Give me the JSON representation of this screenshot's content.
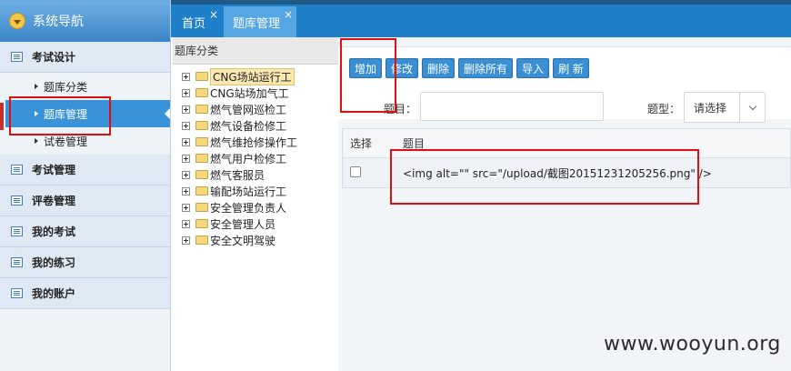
{
  "sidebar": {
    "header": "系统导航",
    "groups": [
      {
        "label": "考试设计"
      },
      {
        "label": "考试管理"
      },
      {
        "label": "评卷管理"
      },
      {
        "label": "我的考试"
      },
      {
        "label": "我的练习"
      },
      {
        "label": "我的账户"
      }
    ],
    "subitems": [
      {
        "label": "题库分类"
      },
      {
        "label": "题库管理"
      },
      {
        "label": "试卷管理"
      }
    ]
  },
  "tabs": [
    {
      "label": "首页",
      "close": "×"
    },
    {
      "label": "题库管理",
      "close": "×"
    }
  ],
  "category_panel": {
    "title": "题库分类",
    "nodes": [
      {
        "label": "CNG场站运行工"
      },
      {
        "label": "CNG站场加气工"
      },
      {
        "label": "燃气管网巡检工"
      },
      {
        "label": "燃气设备检修工"
      },
      {
        "label": "燃气维抢修操作工"
      },
      {
        "label": "燃气用户检修工"
      },
      {
        "label": "燃气客服员"
      },
      {
        "label": "输配场站运行工"
      },
      {
        "label": "安全管理负责人"
      },
      {
        "label": "安全管理人员"
      },
      {
        "label": "安全文明驾驶"
      }
    ]
  },
  "toolbar": {
    "add": "增加",
    "edit": "修改",
    "delete": "删除",
    "delete_all": "删除所有",
    "import": "导入",
    "refresh": "刷 新"
  },
  "filters": {
    "question_label": "题目：",
    "question_value": "",
    "type_label": "题型：",
    "type_value": "请选择"
  },
  "grid": {
    "headers": {
      "select": "选择",
      "question": "题目"
    },
    "rows": [
      {
        "question": "<img alt=\"\" src=\"/upload/截图20151231205256.png\" />"
      }
    ]
  },
  "watermark": "www.wooyun.org",
  "colors": {
    "accent": "#1d80c9",
    "annotation": "#e01010"
  }
}
